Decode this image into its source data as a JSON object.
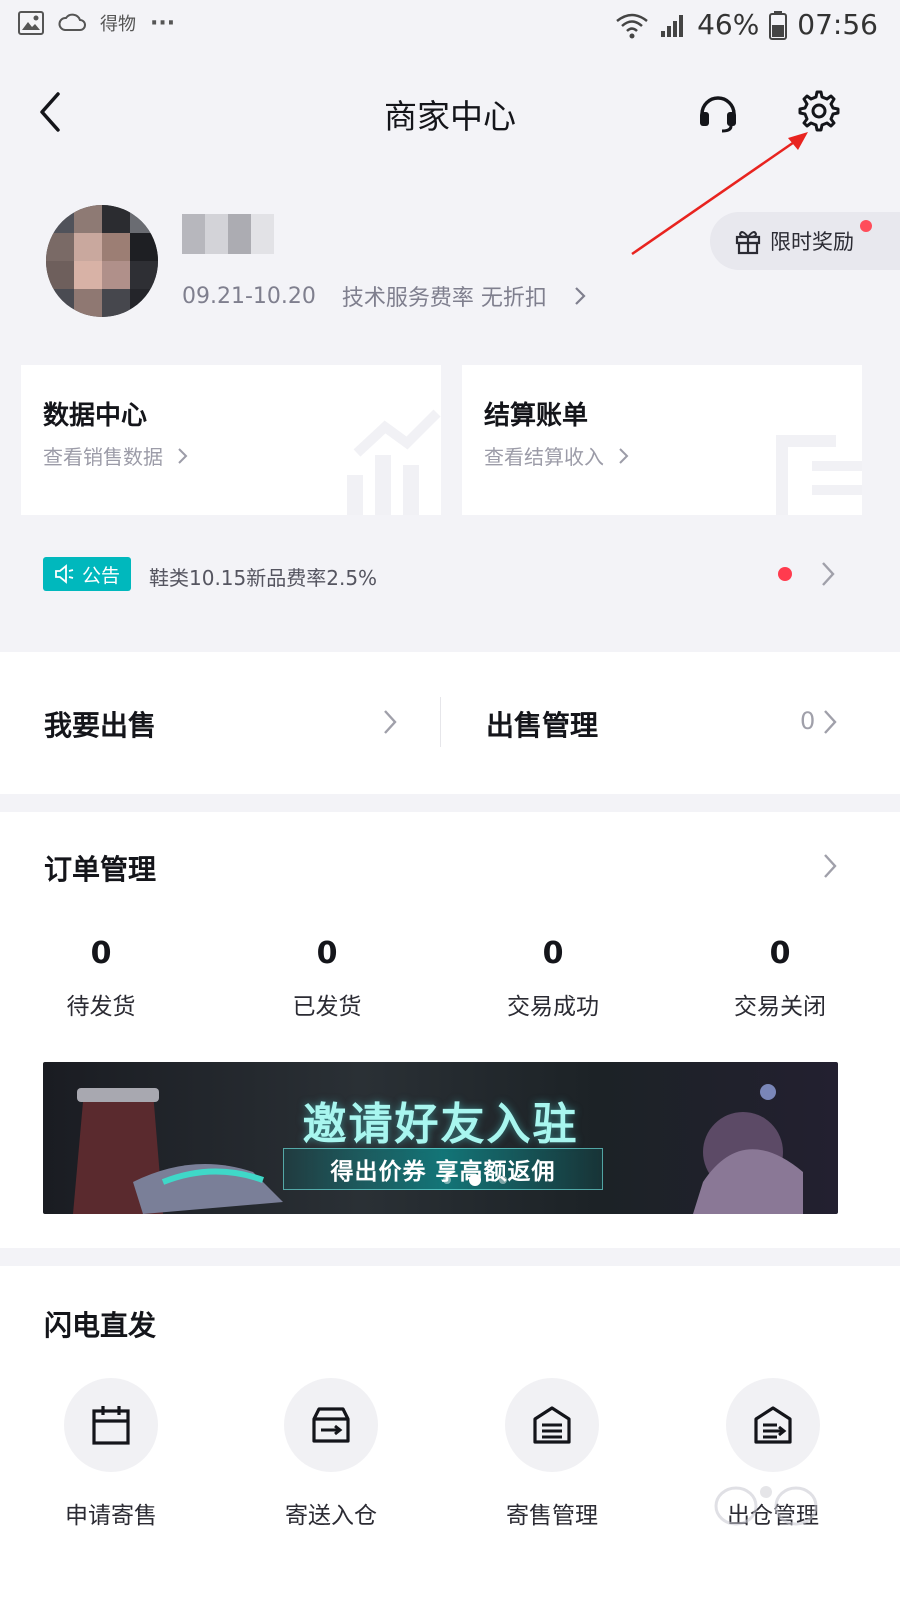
{
  "status_bar": {
    "app_label": "得物",
    "more": "···",
    "battery": "46%",
    "time": "07:56"
  },
  "header": {
    "title": "商家中心"
  },
  "profile": {
    "date_range": "09.21-10.20",
    "fee_label": "技术服务费率 无折扣",
    "reward_label": "限时奖励"
  },
  "cards": {
    "data_center": {
      "title": "数据中心",
      "subtitle": "查看销售数据"
    },
    "settlement": {
      "title": "结算账单",
      "subtitle": "查看结算收入"
    }
  },
  "notice": {
    "badge": "公告",
    "text": "鞋类10.15新品费率2.5%"
  },
  "sell": {
    "sell_label": "我要出售",
    "manage_label": "出售管理",
    "manage_count": "0"
  },
  "orders": {
    "title": "订单管理",
    "stats": [
      {
        "value": "0",
        "label": "待发货"
      },
      {
        "value": "0",
        "label": "已发货"
      },
      {
        "value": "0",
        "label": "交易成功"
      },
      {
        "value": "0",
        "label": "交易关闭"
      }
    ]
  },
  "banner": {
    "title": "邀请好友入驻",
    "subtitle": "得出价券 享高额返佣"
  },
  "flash": {
    "title": "闪电直发",
    "items": [
      {
        "label": "申请寄售",
        "icon": "calendar-icon"
      },
      {
        "label": "寄送入仓",
        "icon": "box-send-icon"
      },
      {
        "label": "寄售管理",
        "icon": "warehouse-icon"
      },
      {
        "label": "出仓管理",
        "icon": "warehouse-out-icon"
      }
    ]
  },
  "colors": {
    "accent_teal": "#00b8bd",
    "alert_red": "#ff3b4e",
    "annotation_red": "#e8231f"
  }
}
